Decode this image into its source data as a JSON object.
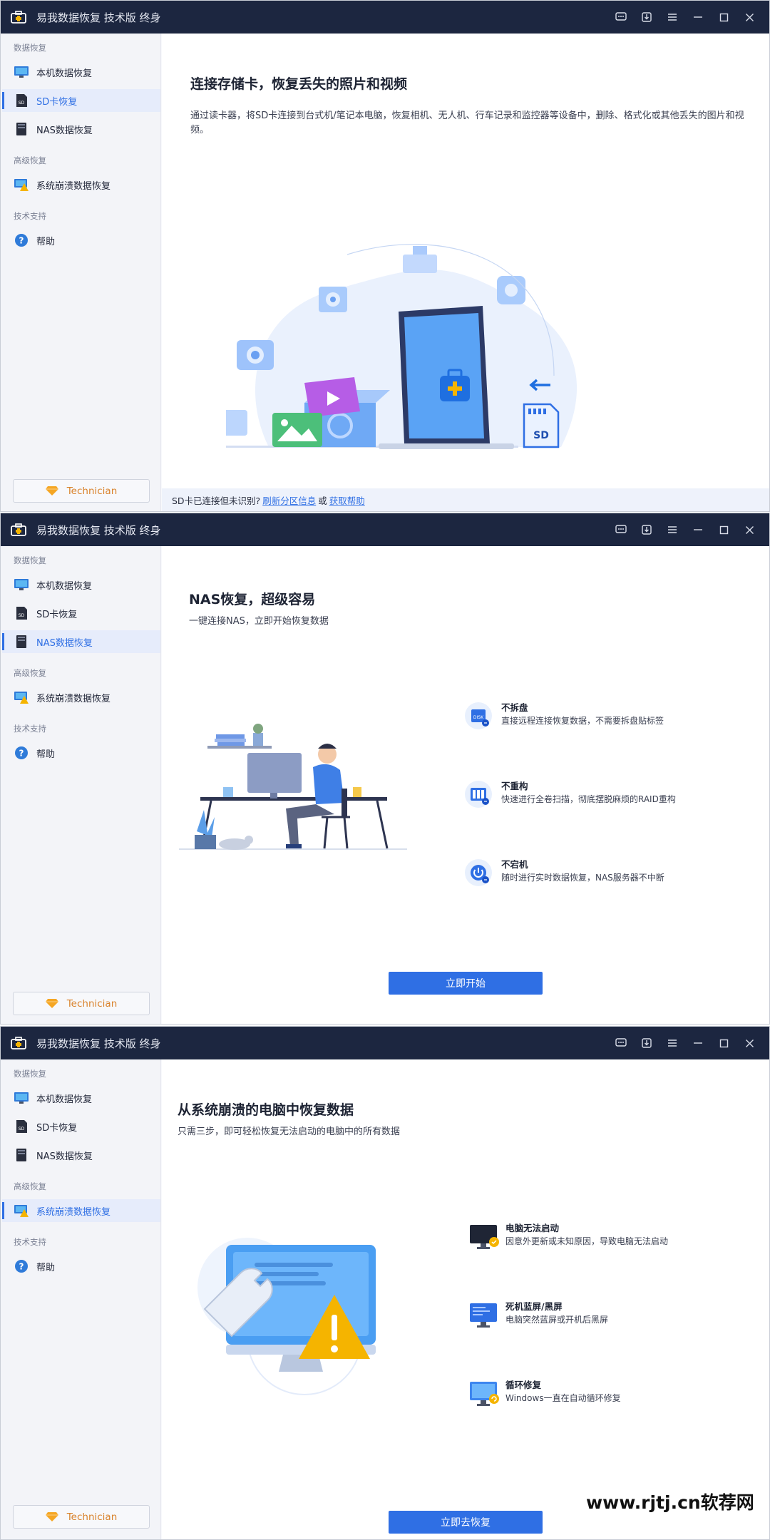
{
  "app": {
    "title": "易我数据恢复 技术版 终身",
    "window_icons": [
      "feedback-icon",
      "download-icon",
      "menu-icon",
      "minimize-icon",
      "maximize-icon",
      "close-icon"
    ]
  },
  "sidebar": {
    "sections": [
      {
        "title": "数据恢复",
        "items": [
          "本机数据恢复",
          "SD卡恢复",
          "NAS数据恢复"
        ]
      },
      {
        "title": "高级恢复",
        "items": [
          "系统崩溃数据恢复"
        ]
      },
      {
        "title": "技术支持",
        "items": [
          "帮助"
        ]
      }
    ],
    "technician_label": "Technician"
  },
  "panel1": {
    "active_item": "SD卡恢复",
    "heading": "连接存储卡，恢复丢失的照片和视频",
    "description": "通过读卡器，将SD卡连接到台式机/笔记本电脑，恢复相机、无人机、行车记录和监控器等设备中，删除、格式化或其他丢失的图片和视频。",
    "sd_label": "SD",
    "bottom_text": "SD卡已连接但未识别?",
    "bottom_link1": "刷新分区信息",
    "bottom_or": "或",
    "bottom_link2": "获取帮助"
  },
  "panel2": {
    "active_item": "NAS数据恢复",
    "heading": "NAS恢复，超级容易",
    "subheading": "一键连接NAS，立即开始恢复数据",
    "features": [
      {
        "title": "不拆盘",
        "desc": "直接远程连接恢复数据，不需要拆盘贴标签",
        "icon": "disk-icon"
      },
      {
        "title": "不重构",
        "desc": "快速进行全卷扫描，彻底摆脱麻烦的RAID重构",
        "icon": "raid-icon"
      },
      {
        "title": "不宕机",
        "desc": "随时进行实时数据恢复，NAS服务器不中断",
        "icon": "power-icon"
      }
    ],
    "disk_label": "DISK",
    "cta": "立即开始"
  },
  "panel3": {
    "active_item": "系统崩溃数据恢复",
    "heading": "从系统崩溃的电脑中恢复数据",
    "subheading": "只需三步，即可轻松恢复无法启动的电脑中的所有数据",
    "features": [
      {
        "title": "电脑无法启动",
        "desc": "因意外更新或未知原因，导致电脑无法启动",
        "icon": "monitor-off-icon"
      },
      {
        "title": "死机蓝屏/黑屏",
        "desc": "电脑突然蓝屏或开机后黑屏",
        "icon": "monitor-bluescreen-icon"
      },
      {
        "title": "循环修复",
        "desc": "Windows一直在自动循环修复",
        "icon": "monitor-loop-icon"
      }
    ],
    "cta": "立即去恢复"
  },
  "watermark": "www.rjtj.cn软荐网",
  "colors": {
    "accent": "#2f6fe4",
    "titlebar": "#1c2640",
    "technician": "#d9822b"
  }
}
